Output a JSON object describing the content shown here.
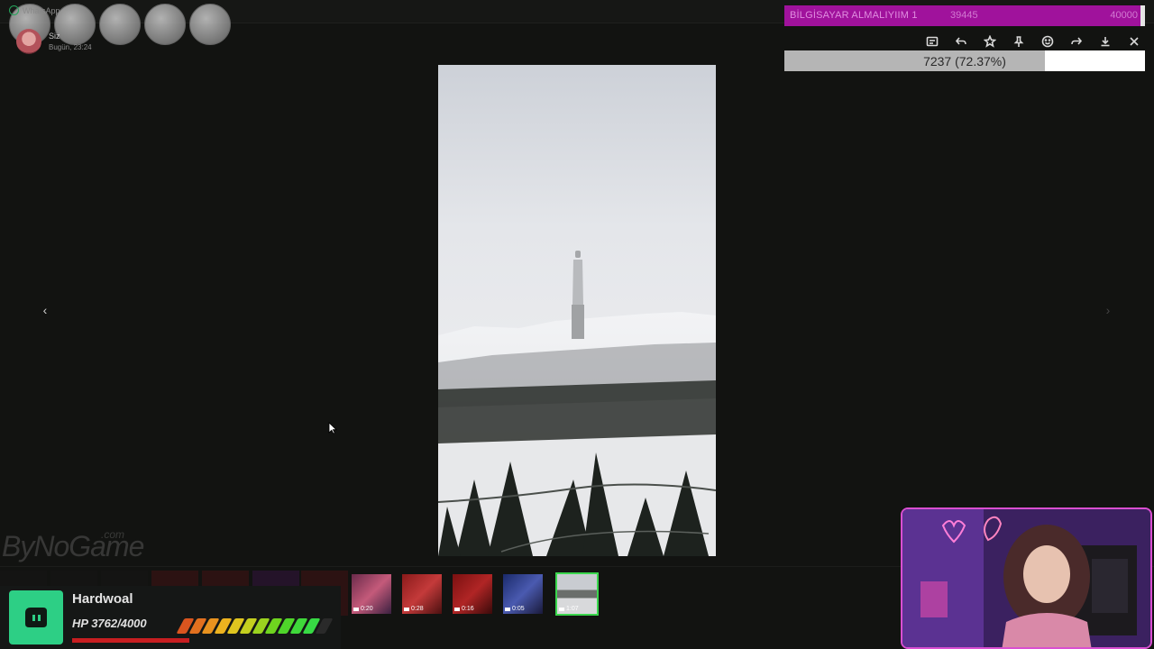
{
  "app": {
    "notification_source": "WhatsApp",
    "sender_name": "Siz",
    "sender_time": "Bugün, 23:24"
  },
  "goal": {
    "title": "BİLGİSAYAR ALMALIYIIM 1",
    "current": "39445",
    "target": "40000",
    "color": "#a0129c"
  },
  "toolbar": {
    "items": [
      "caption-icon",
      "reply-icon",
      "star-icon",
      "pin-icon",
      "emoji-icon",
      "forward-icon",
      "download-icon",
      "close-icon"
    ]
  },
  "progress": {
    "label": "7237 (72.37%)",
    "fraction": 0.7237
  },
  "viewer": {
    "prev_icon": "‹",
    "next_icon": "›"
  },
  "watermark": {
    "text": "ByNoGame",
    "suffix": ".com"
  },
  "thumbnails": [
    {
      "duration": "0:20"
    },
    {
      "duration": "0:28"
    },
    {
      "duration": "0:16"
    },
    {
      "duration": "0:05"
    },
    {
      "duration": "1:07",
      "selected": true
    }
  ],
  "hp_panel": {
    "name": "Hardwoal",
    "hp_text": "HP 3762/4000",
    "hp_fraction": 0.9405
  }
}
